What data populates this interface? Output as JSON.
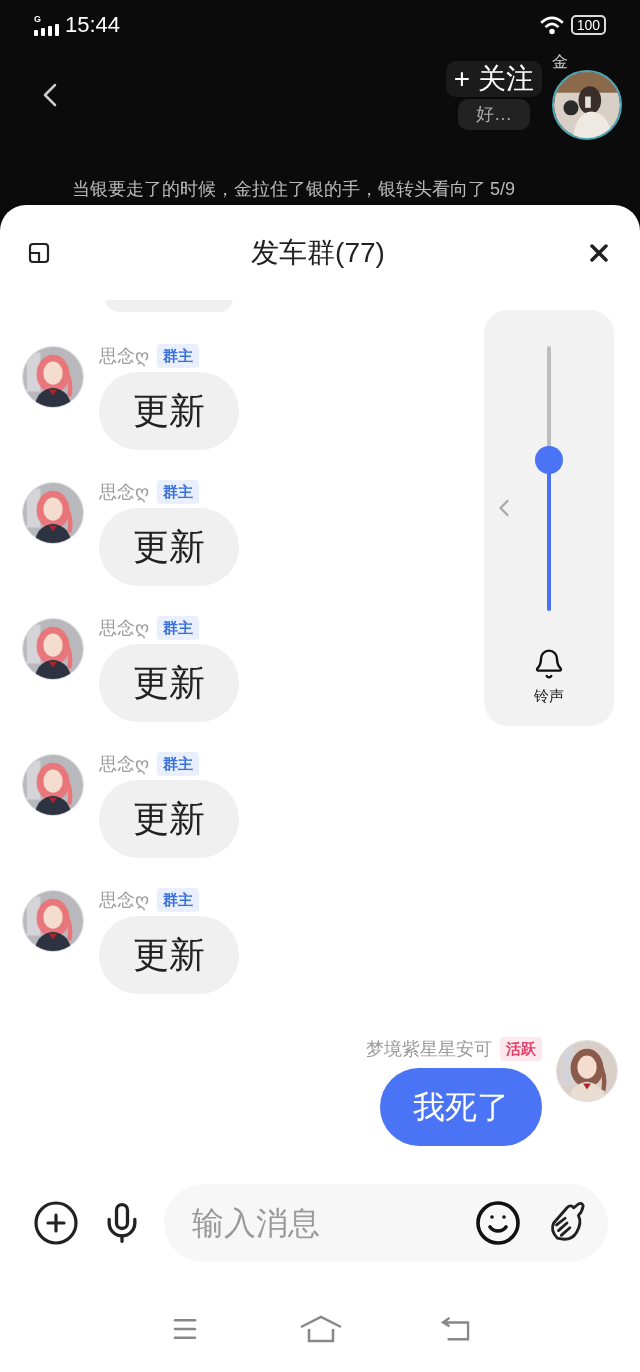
{
  "status_bar": {
    "network": "G",
    "time": "15:44",
    "battery": "100"
  },
  "top_bar": {
    "author_tag": "金",
    "follow_button": "+ 关注",
    "popup_text": "好…",
    "caption": "当银要走了的时候，金拉住了银的手，银转头看向了",
    "page_counter": "5/9"
  },
  "sheet": {
    "title": "发车群(77)"
  },
  "messages": [
    {
      "kind": "incoming",
      "sender": "思念ღ",
      "badge": {
        "kind": "owner",
        "text": "群主"
      },
      "text": "更新"
    },
    {
      "kind": "incoming",
      "sender": "思念ღ",
      "badge": {
        "kind": "owner",
        "text": "群主"
      },
      "text": "更新"
    },
    {
      "kind": "incoming",
      "sender": "思念ღ",
      "badge": {
        "kind": "owner",
        "text": "群主"
      },
      "text": "更新"
    },
    {
      "kind": "incoming",
      "sender": "思念ღ",
      "badge": {
        "kind": "owner",
        "text": "群主"
      },
      "text": "更新"
    },
    {
      "kind": "incoming",
      "sender": "思念ღ",
      "badge": {
        "kind": "owner",
        "text": "群主"
      },
      "text": "更新"
    },
    {
      "kind": "outgoing",
      "sender": "梦境紫星星安可",
      "badge": {
        "kind": "active",
        "text": "活跃"
      },
      "text": "我死了"
    }
  ],
  "volume_panel": {
    "level": 0.57,
    "label": "铃声"
  },
  "input": {
    "placeholder": "输入消息"
  }
}
